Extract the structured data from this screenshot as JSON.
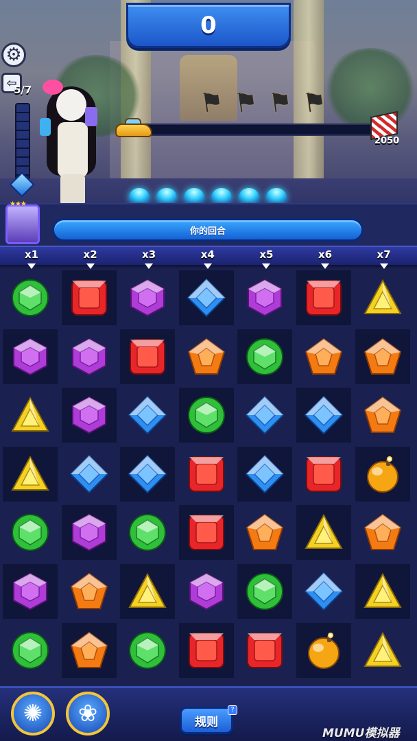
{
  "header": {
    "score": "0",
    "moves": "5/7",
    "target_score": "2050"
  },
  "turn": {
    "label": "你的回合"
  },
  "multipliers": [
    "x1",
    "x2",
    "x3",
    "x4",
    "x5",
    "x6",
    "x7"
  ],
  "race": {
    "flags_count": 4,
    "pads_count": 6
  },
  "board": {
    "rows": [
      [
        "green",
        "red",
        "purple",
        "blue",
        "purple",
        "red",
        "yellow"
      ],
      [
        "purple",
        "purple",
        "red",
        "orange",
        "green",
        "orange",
        "orange"
      ],
      [
        "yellow",
        "purple",
        "blue",
        "green",
        "blue",
        "blue",
        "orange"
      ],
      [
        "yellow",
        "blue",
        "blue",
        "red",
        "blue",
        "red",
        "bomb"
      ],
      [
        "green",
        "purple",
        "green",
        "red",
        "orange",
        "yellow",
        "orange"
      ],
      [
        "purple",
        "orange",
        "yellow",
        "purple",
        "green",
        "blue",
        "yellow"
      ],
      [
        "green",
        "orange",
        "green",
        "red",
        "red",
        "bomb",
        "yellow"
      ]
    ]
  },
  "gem_colors": {
    "green": "#2fbf3a",
    "red": "#e8262a",
    "purple": "#b03cd8",
    "blue": "#2f8ff0",
    "yellow": "#f4d224",
    "orange": "#f47a12",
    "bomb": "#f6a612"
  },
  "footer": {
    "booster1_icon": "sun-burst-icon",
    "booster2_icon": "rose-icon",
    "rules_label": "规则",
    "rules_help": "?",
    "watermark": "MUMU模拟器"
  }
}
